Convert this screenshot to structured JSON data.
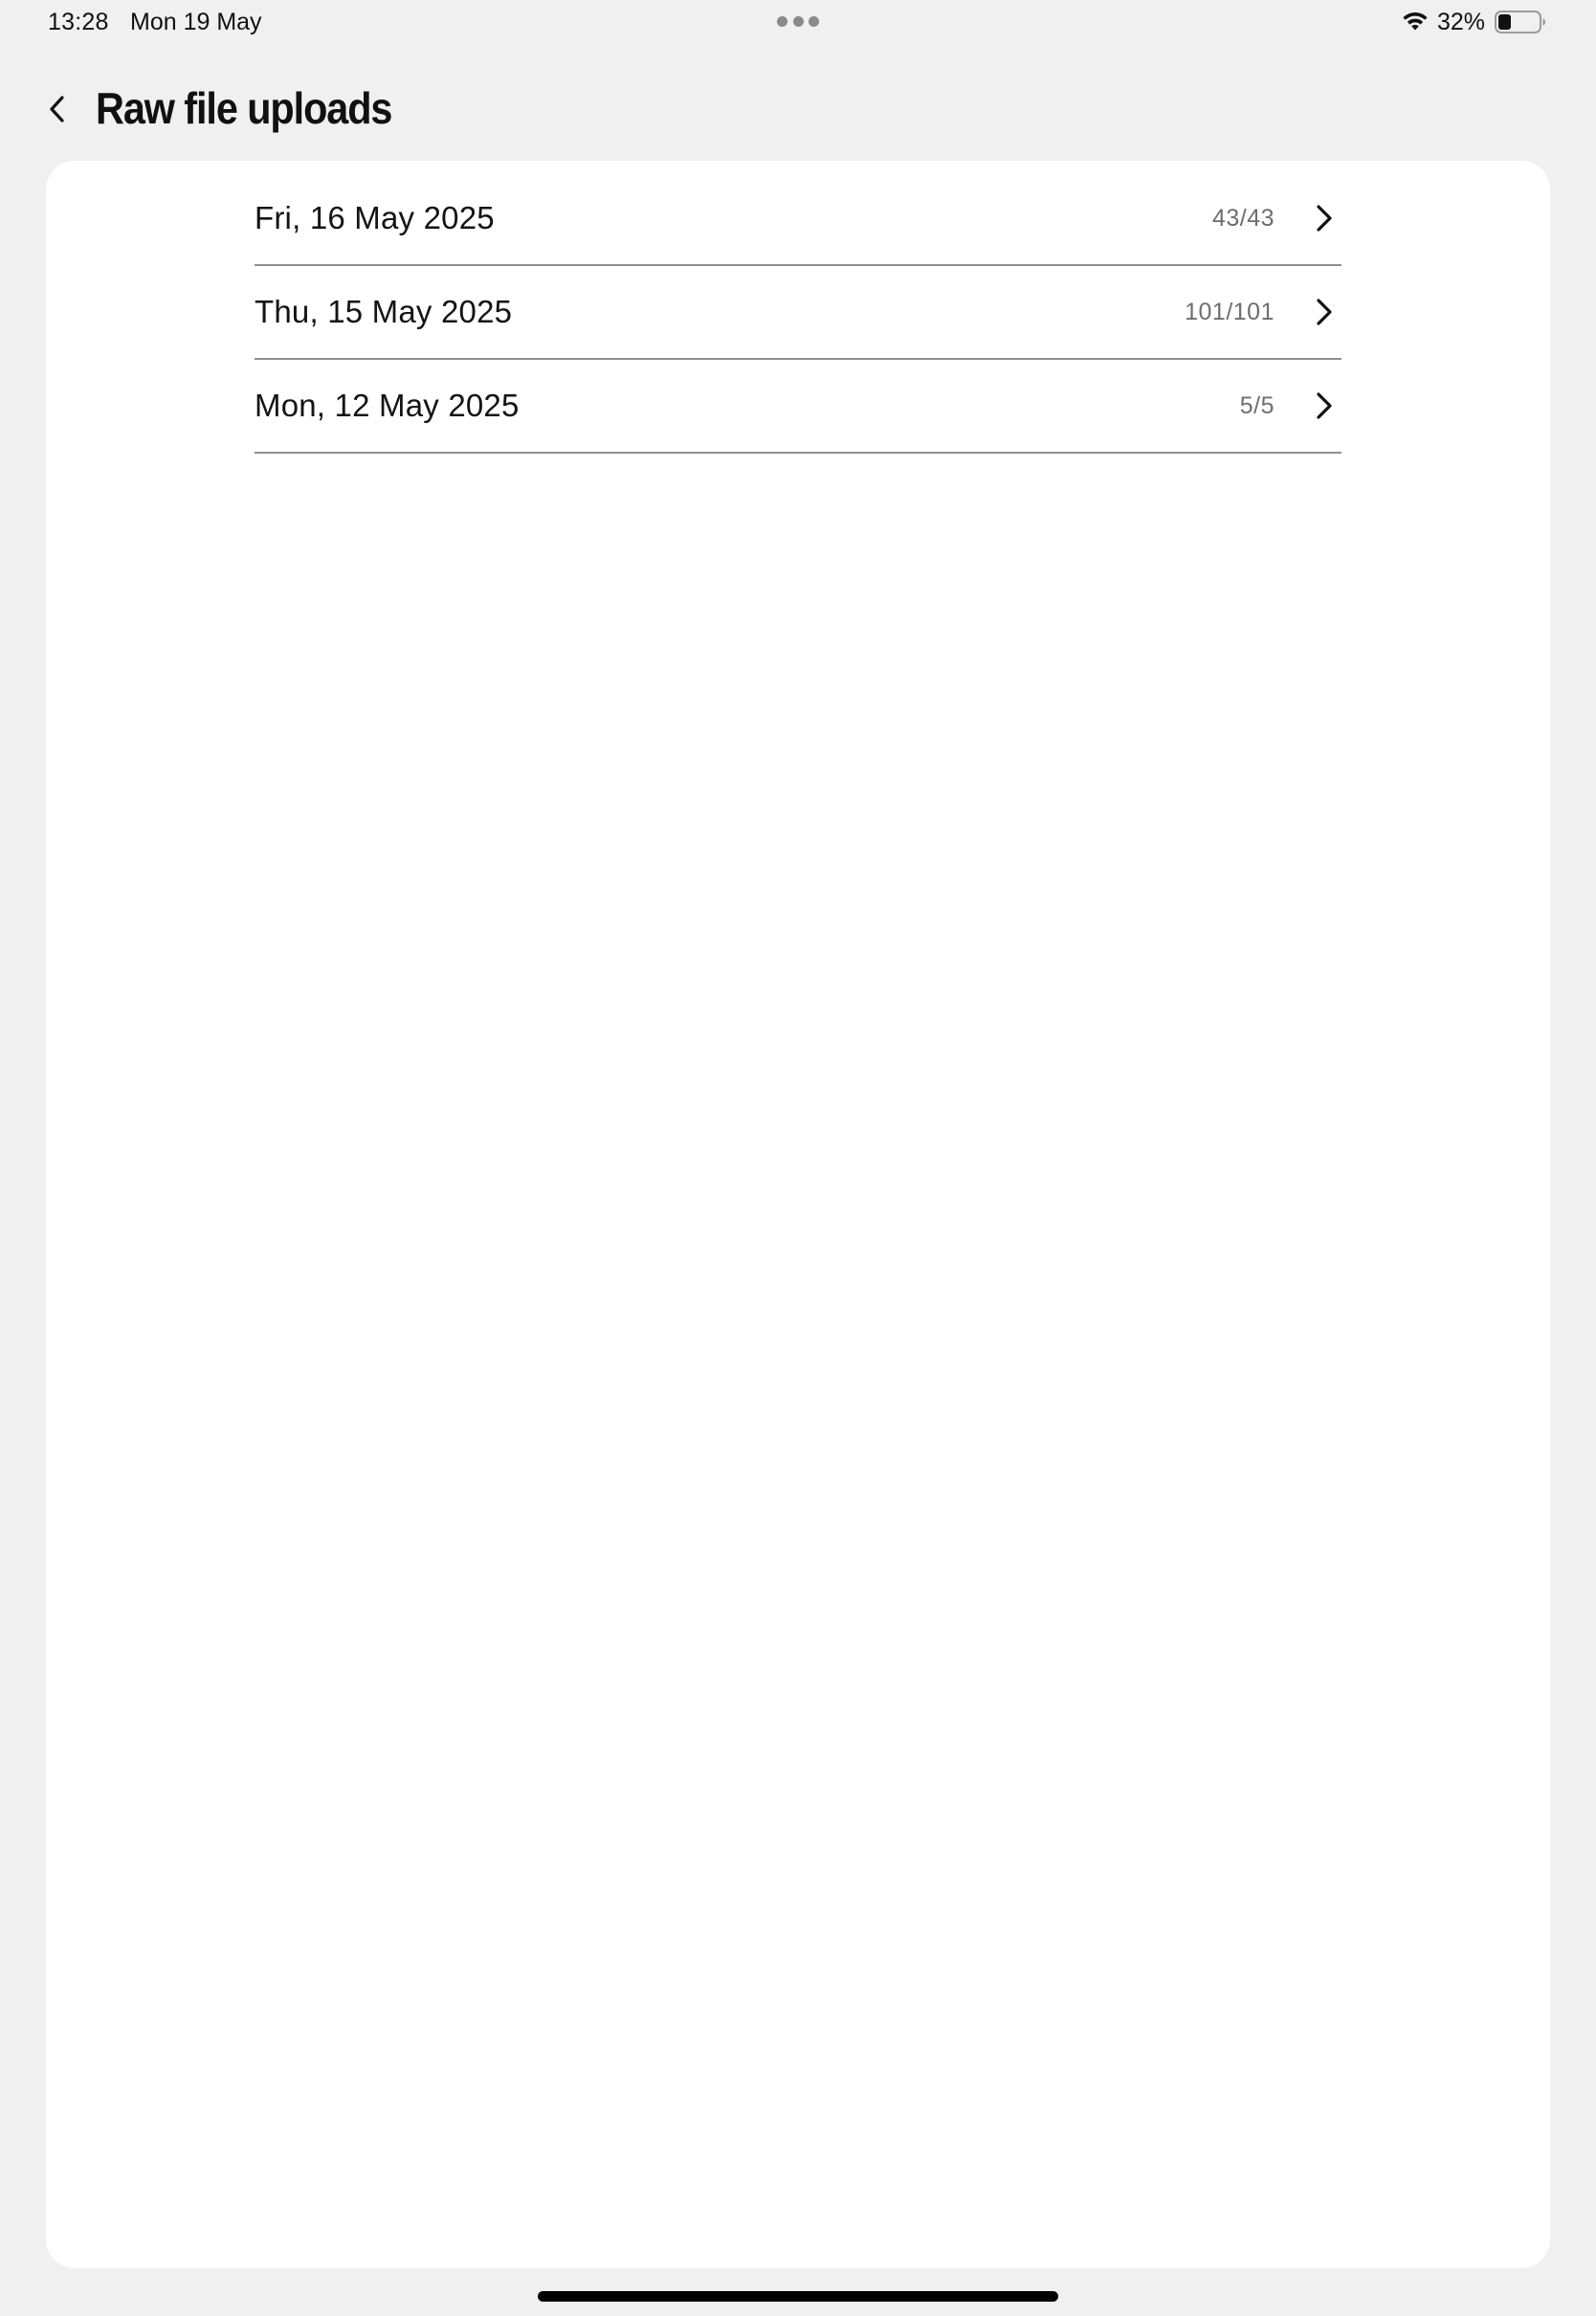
{
  "status_bar": {
    "time": "13:28",
    "date": "Mon 19 May",
    "battery_percent": "32%",
    "battery_level": 0.32
  },
  "header": {
    "title": "Raw file uploads",
    "back_icon": "chevron-left-icon"
  },
  "uploads": [
    {
      "date": "Fri, 16 May 2025",
      "count": "43/43"
    },
    {
      "date": "Thu, 15 May 2025",
      "count": "101/101"
    },
    {
      "date": "Mon, 12 May 2025",
      "count": "5/5"
    }
  ],
  "icons": {
    "row_chevron": "chevron-right-icon",
    "wifi": "wifi-icon",
    "battery": "battery-icon"
  },
  "colors": {
    "background": "#f0f0f0",
    "card": "#ffffff",
    "divider": "#8e8e8e",
    "count_text": "#6e6e6e"
  }
}
